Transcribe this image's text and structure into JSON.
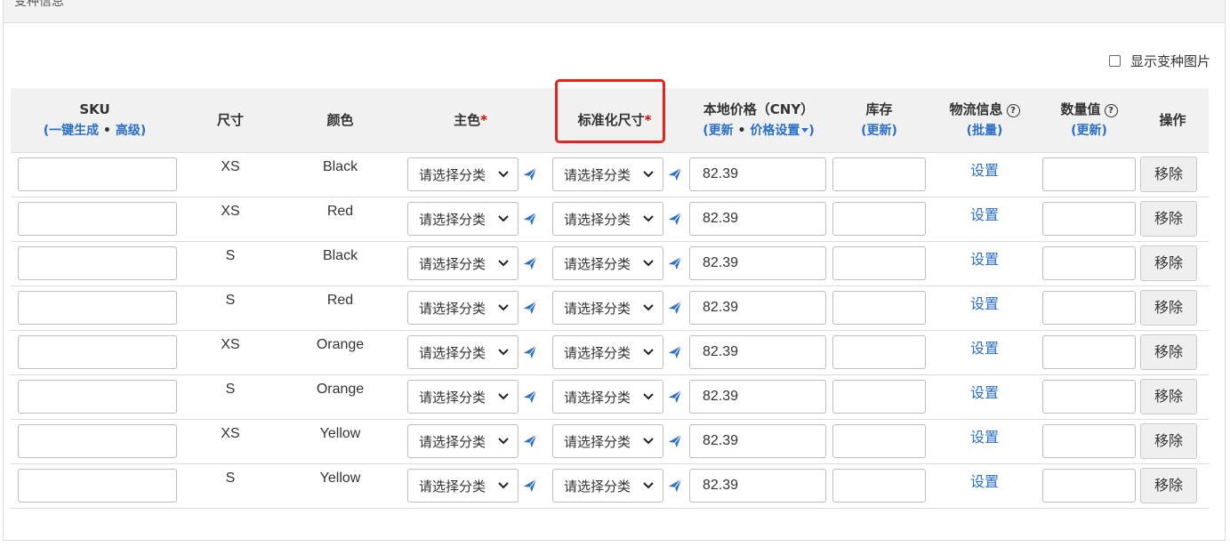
{
  "panel": {
    "title": "变种信息"
  },
  "show_images": {
    "label": "显示变种图片"
  },
  "headers": {
    "sku": "SKU",
    "sku_open": "(",
    "sku_gen": "一键生成",
    "sku_dot": "•",
    "sku_adv": "高级",
    "sku_close": ")",
    "size": "尺寸",
    "color": "颜色",
    "main_color": "主色",
    "std_size": "标准化尺寸",
    "required_mark": "*",
    "price": "本地价格（CNY）",
    "price_open": "(",
    "price_update": "更新",
    "price_dot": "•",
    "price_setting": "价格设置",
    "price_close": ")",
    "stock": "库存",
    "stock_open": "(",
    "stock_update": "更新",
    "stock_close": ")",
    "logistics": "物流信息",
    "logistics_open": "(",
    "logistics_batch": "批量",
    "logistics_close": ")",
    "quantity": "数量值",
    "quantity_open": "(",
    "quantity_update": "更新",
    "quantity_close": ")",
    "help_glyph": "?",
    "action": "操作"
  },
  "select_placeholder": "请选择分类",
  "logistics_link": "设置",
  "remove_label": "移除",
  "rows": [
    {
      "size": "XS",
      "color": "Black",
      "price": "82.39"
    },
    {
      "size": "XS",
      "color": "Red",
      "price": "82.39"
    },
    {
      "size": "S",
      "color": "Black",
      "price": "82.39"
    },
    {
      "size": "S",
      "color": "Red",
      "price": "82.39"
    },
    {
      "size": "XS",
      "color": "Orange",
      "price": "82.39"
    },
    {
      "size": "S",
      "color": "Orange",
      "price": "82.39"
    },
    {
      "size": "XS",
      "color": "Yellow",
      "price": "82.39"
    },
    {
      "size": "S",
      "color": "Yellow",
      "price": "82.39"
    }
  ],
  "colors": {
    "link": "#2a6fc9",
    "required": "#e60000",
    "highlight": "#e8221a"
  }
}
